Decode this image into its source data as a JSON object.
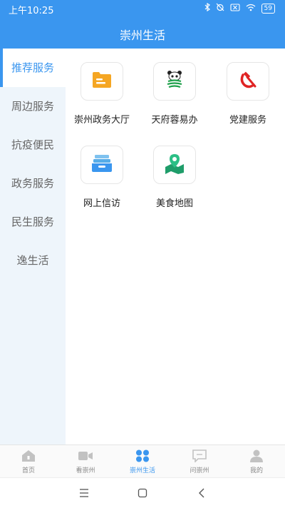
{
  "status_bar": {
    "time": "上午10:25",
    "battery": "59"
  },
  "header": {
    "title": "崇州生活"
  },
  "sidebar": {
    "items": [
      {
        "label": "推荐服务"
      },
      {
        "label": "周边服务"
      },
      {
        "label": "抗疫便民"
      },
      {
        "label": "政务服务"
      },
      {
        "label": "民生服务"
      },
      {
        "label": "逸生活"
      }
    ]
  },
  "services": [
    {
      "label": "崇州政务大厅",
      "icon": "folder-icon"
    },
    {
      "label": "天府蓉易办",
      "icon": "panda-icon"
    },
    {
      "label": "党建服务",
      "icon": "hammer-sickle-icon"
    },
    {
      "label": "网上信访",
      "icon": "inbox-tray-icon"
    },
    {
      "label": "美食地图",
      "icon": "map-pin-icon"
    }
  ],
  "bottom_nav": {
    "items": [
      {
        "label": "首页",
        "icon": "home-icon"
      },
      {
        "label": "看崇州",
        "icon": "video-camera-icon"
      },
      {
        "label": "崇州生活",
        "icon": "grid-icon"
      },
      {
        "label": "问崇州",
        "icon": "chat-icon"
      },
      {
        "label": "我的",
        "icon": "user-icon"
      }
    ]
  },
  "colors": {
    "primary": "#3a96ef",
    "sidebar_bg": "#eef5fb"
  }
}
